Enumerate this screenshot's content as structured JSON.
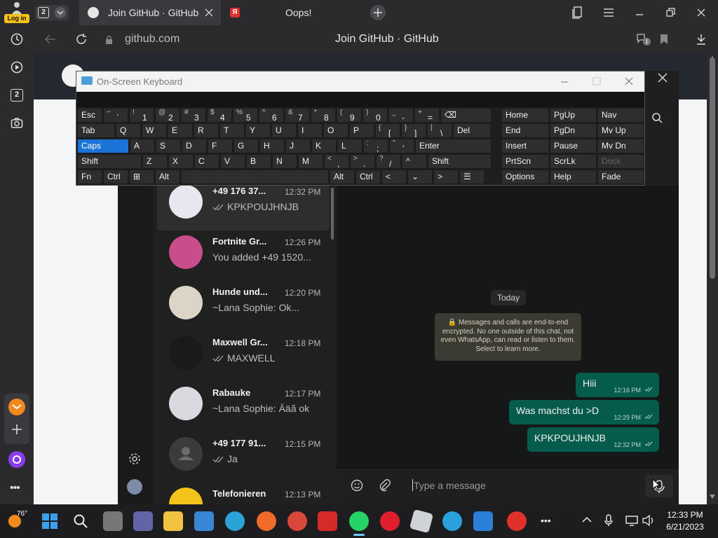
{
  "browser": {
    "login_label": "Log in",
    "tab_count": "2",
    "tabs": [
      {
        "title": "Join GitHub · GitHub"
      },
      {
        "title": "Oops!"
      }
    ],
    "url": "github.com",
    "page_title": "Join GitHub · GitHub",
    "sidebar_tab_count": "2",
    "weather": "76°",
    "protect_count": "1"
  },
  "keyboard": {
    "title": "On-Screen Keyboard",
    "rows": [
      [
        {
          "label": "Esc"
        },
        {
          "shift": "~",
          "main": "`"
        },
        {
          "shift": "!",
          "main": "1"
        },
        {
          "shift": "@",
          "main": "2"
        },
        {
          "shift": "#",
          "main": "3"
        },
        {
          "shift": "$",
          "main": "4"
        },
        {
          "shift": "%",
          "main": "5"
        },
        {
          "shift": "^",
          "main": "6"
        },
        {
          "shift": "&",
          "main": "7"
        },
        {
          "shift": "*",
          "main": "8"
        },
        {
          "shift": "(",
          "main": "9"
        },
        {
          "shift": ")",
          "main": "0"
        },
        {
          "shift": "_",
          "main": "-"
        },
        {
          "shift": "+",
          "main": "="
        },
        {
          "label": "⌫"
        }
      ],
      [
        {
          "label": "Tab"
        },
        {
          "label": "Q"
        },
        {
          "label": "W"
        },
        {
          "label": "E"
        },
        {
          "label": "R"
        },
        {
          "label": "T"
        },
        {
          "label": "Y"
        },
        {
          "label": "U"
        },
        {
          "label": "I"
        },
        {
          "label": "O"
        },
        {
          "label": "P"
        },
        {
          "shift": "{",
          "main": "["
        },
        {
          "shift": "}",
          "main": "]"
        },
        {
          "shift": "|",
          "main": "\\"
        },
        {
          "label": "Del"
        }
      ],
      [
        {
          "label": "Caps"
        },
        {
          "label": "A"
        },
        {
          "label": "S"
        },
        {
          "label": "D"
        },
        {
          "label": "F"
        },
        {
          "label": "G"
        },
        {
          "label": "H"
        },
        {
          "label": "J"
        },
        {
          "label": "K"
        },
        {
          "label": "L"
        },
        {
          "shift": ":",
          "main": ";"
        },
        {
          "shift": "\"",
          "main": "'"
        },
        {
          "label": "Enter"
        }
      ],
      [
        {
          "label": "Shift"
        },
        {
          "label": "Z"
        },
        {
          "label": "X"
        },
        {
          "label": "C"
        },
        {
          "label": "V"
        },
        {
          "label": "B"
        },
        {
          "label": "N"
        },
        {
          "label": "M"
        },
        {
          "shift": "<",
          "main": ","
        },
        {
          "shift": ">",
          "main": "."
        },
        {
          "shift": "?",
          "main": "/"
        },
        {
          "label": "^"
        },
        {
          "label": "Shift"
        }
      ],
      [
        {
          "label": "Fn"
        },
        {
          "label": "Ctrl"
        },
        {
          "label": "⊞"
        },
        {
          "label": "Alt"
        },
        {
          "label": ""
        },
        {
          "label": "Alt"
        },
        {
          "label": "Ctrl"
        },
        {
          "label": "<"
        },
        {
          "label": "⌄"
        },
        {
          "label": ">"
        },
        {
          "label": "☰"
        }
      ]
    ],
    "nav_keys": [
      [
        "Home",
        "PgUp",
        "Nav"
      ],
      [
        "End",
        "PgDn",
        "Mv Up"
      ],
      [
        "Insert",
        "Pause",
        "Mv Dn"
      ],
      [
        "PrtScn",
        "ScrLk",
        "Dock"
      ],
      [
        "Options",
        "Help",
        "Fade"
      ]
    ]
  },
  "whatsapp": {
    "chats": [
      {
        "name": "+49 176 37...",
        "time": "12:32 PM",
        "preview": "KPKPOUJHNJB",
        "ticks": true
      },
      {
        "name": "Fortnite Gr...",
        "time": "12:26 PM",
        "preview": "You added +49 1520...",
        "ticks": false
      },
      {
        "name": "Hunde und...",
        "time": "12:20 PM",
        "preview": "~Lana Sophie: Ok...",
        "ticks": false
      },
      {
        "name": "Maxwell Gr...",
        "time": "12:18 PM",
        "preview": "MAXWELL",
        "ticks": true
      },
      {
        "name": "Rabauke",
        "time": "12:17 PM",
        "preview": "~Lana Sophie: Ääã ok",
        "ticks": false
      },
      {
        "name": "+49 177 91...",
        "time": "12:15 PM",
        "preview": "Ja",
        "ticks": true
      },
      {
        "name": "Telefonieren",
        "time": "12:13 PM",
        "preview": "",
        "ticks": false
      }
    ],
    "date_label": "Today",
    "encryption_notice": "🔒 Messages and calls are end-to-end encrypted. No one outside of this chat, not even WhatsApp, can read or listen to them. Select to learn more.",
    "messages": [
      {
        "text": "Hiii",
        "time": "12:16 PM"
      },
      {
        "text": "Was machst du >D",
        "time": "12:29 PM"
      },
      {
        "text": "KPKPOUJHNJB",
        "time": "12:32 PM"
      }
    ],
    "input_placeholder": "Type a message"
  },
  "taskbar": {
    "time": "12:33 PM",
    "date": "6/21/2023"
  },
  "colors": {
    "accent_caps": "#1a73d6",
    "bubble_out": "#065c4c"
  }
}
